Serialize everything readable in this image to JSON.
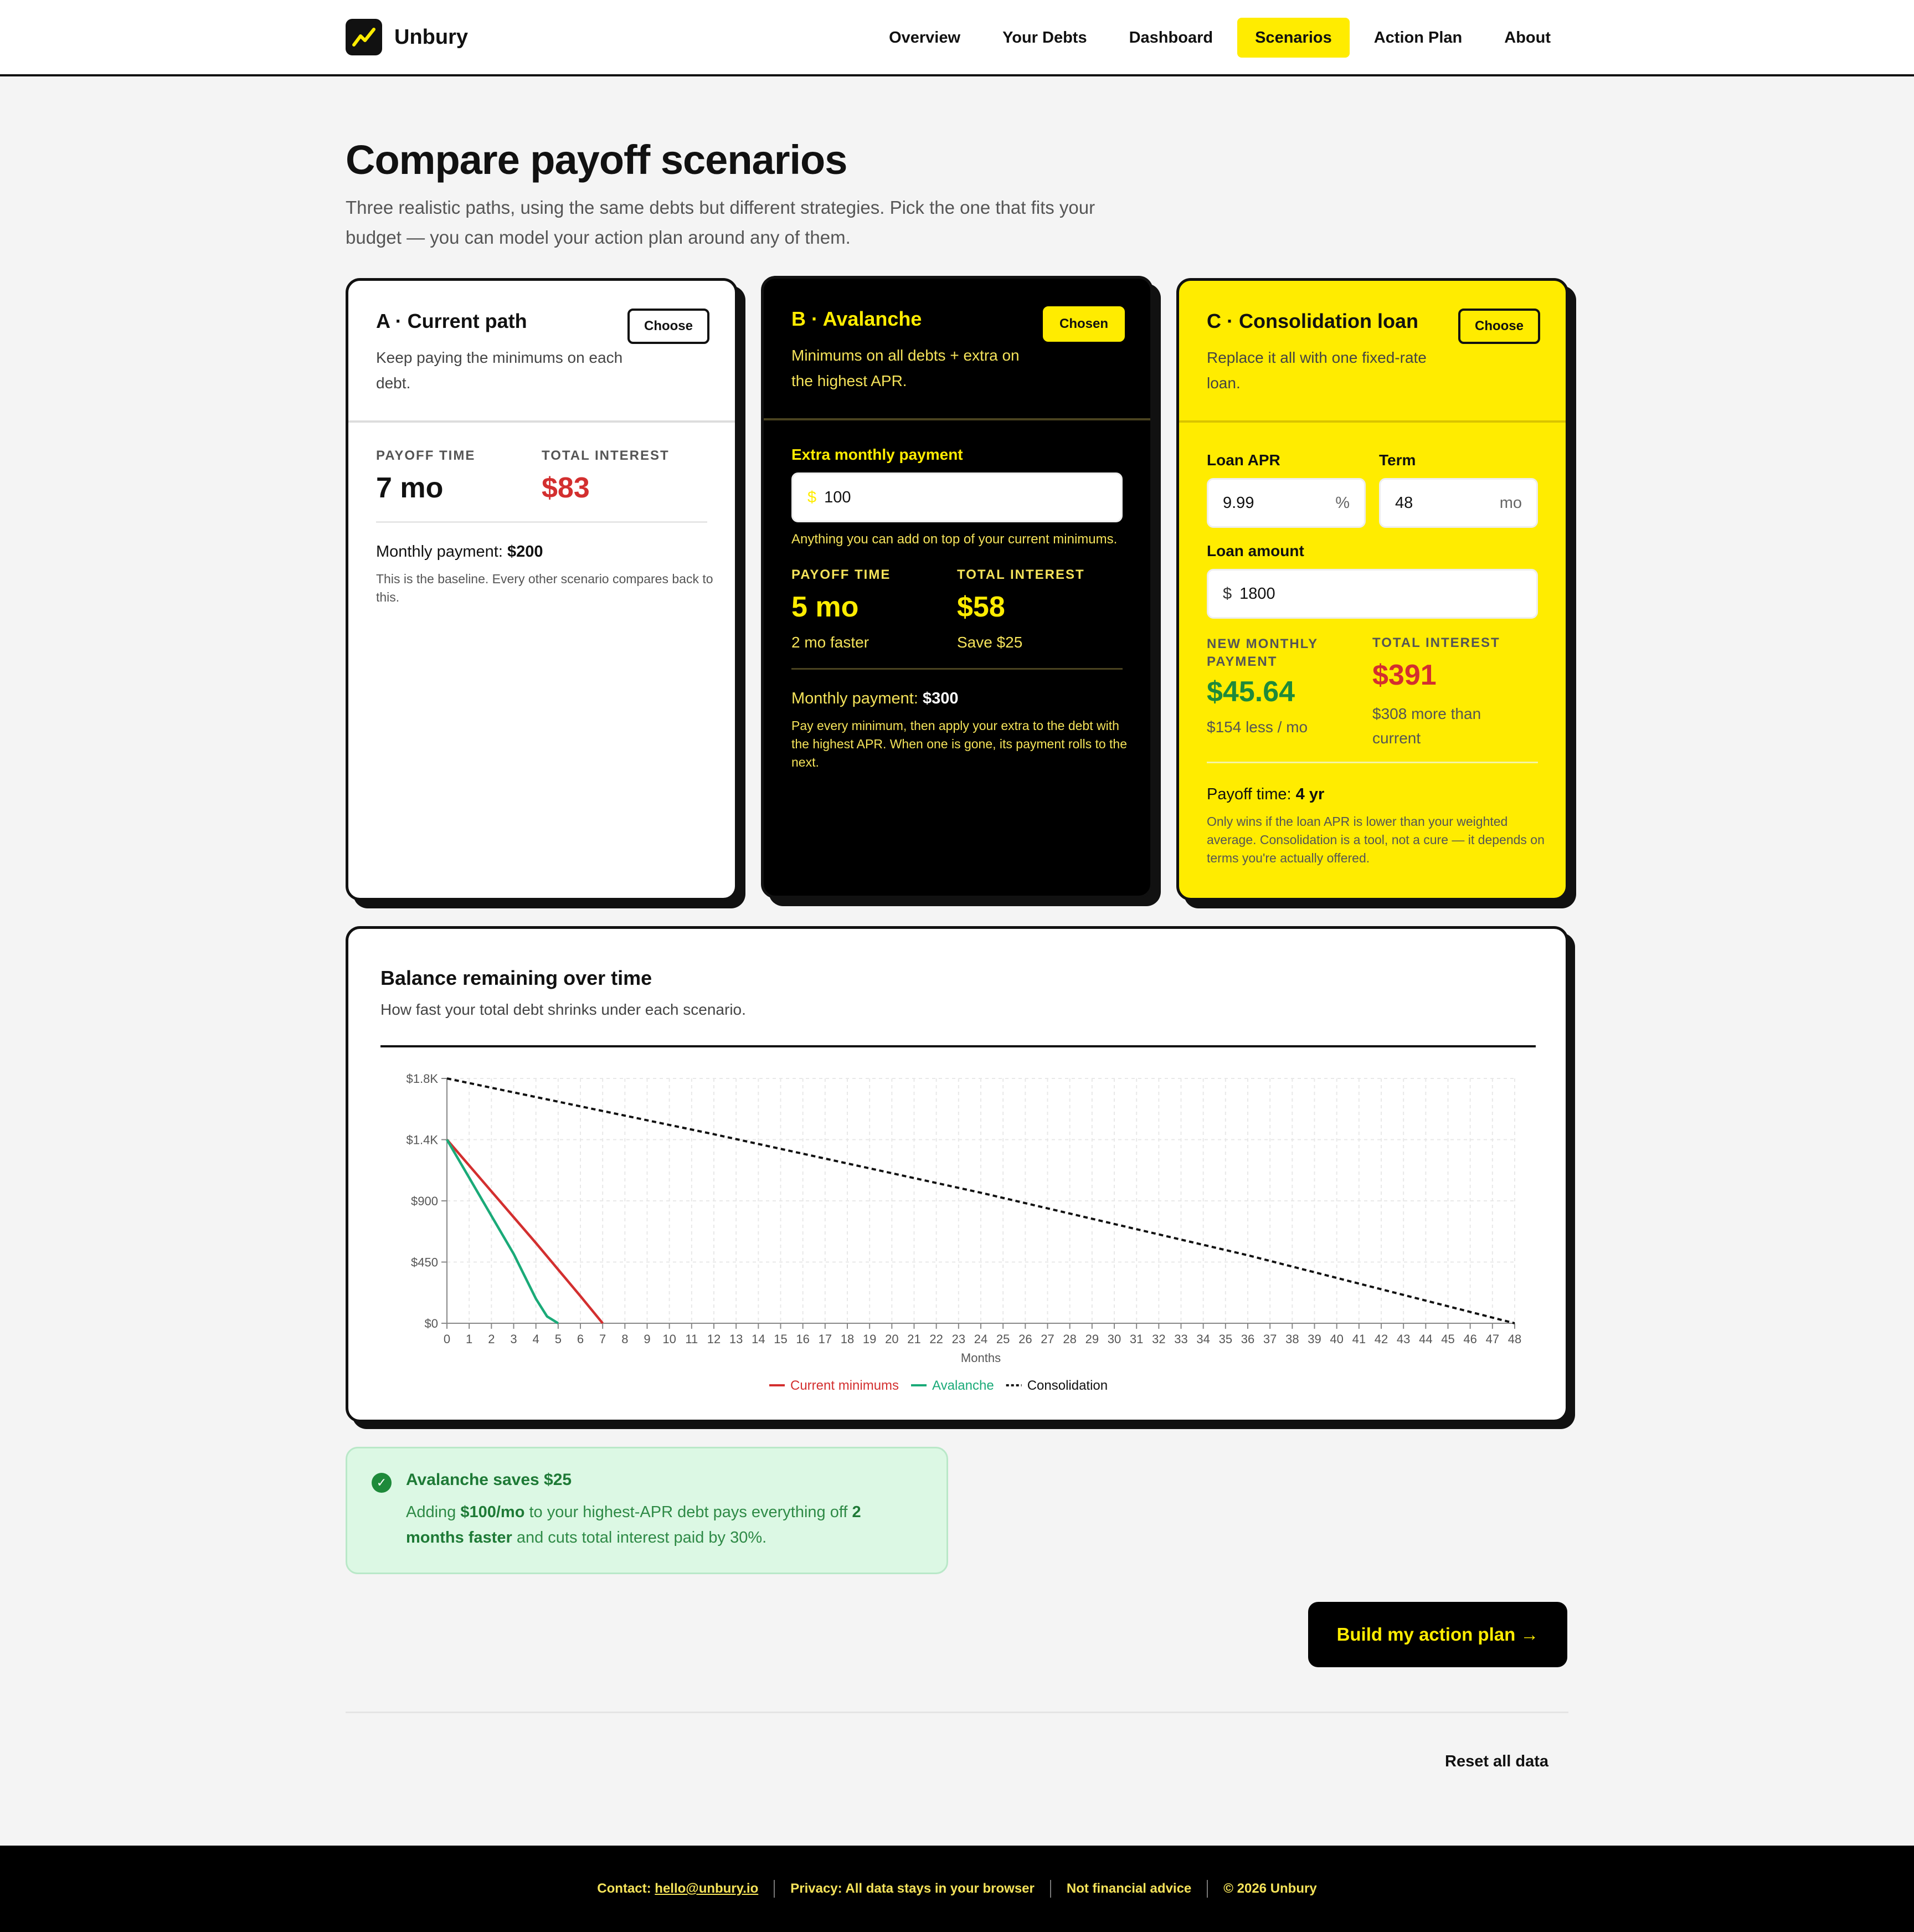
{
  "app": {
    "name": "Unbury",
    "nav": [
      "Overview",
      "Your Debts",
      "Dashboard",
      "Scenarios",
      "Action Plan",
      "About"
    ],
    "active_nav": "Scenarios"
  },
  "page": {
    "title": "Compare payoff scenarios",
    "subtitle": "Three realistic paths, using the same debts but different strategies. Pick the one that fits your budget — you can model your action plan around any of them."
  },
  "card_a": {
    "title": "A · Current path",
    "desc": "Keep paying the minimums on each debt.",
    "button": "Choose",
    "payoff_label": "PAYOFF TIME",
    "payoff_value": "7 mo",
    "interest_label": "TOTAL INTEREST",
    "interest_value": "$83",
    "monthly_label": "Monthly payment:",
    "monthly_value": "$200",
    "note": "This is the baseline. Every other scenario compares back to this."
  },
  "card_b": {
    "title": "B · Avalanche",
    "desc": "Minimums on all debts + extra on the highest APR.",
    "button": "Chosen",
    "extra_label": "Extra monthly payment",
    "extra_prefix": "$",
    "extra_value": "100",
    "extra_help": "Anything you can add on top of your current minimums.",
    "payoff_label": "PAYOFF TIME",
    "payoff_value": "5 mo",
    "payoff_note": "2 mo faster",
    "interest_label": "TOTAL INTEREST",
    "interest_value": "$58",
    "interest_note": "Save $25",
    "monthly_label": "Monthly payment:",
    "monthly_value": "$300",
    "note": "Pay every minimum, then apply your extra to the debt with the highest APR. When one is gone, its payment rolls to the next."
  },
  "card_c": {
    "title": "C · Consolidation loan",
    "desc": "Replace it all with one fixed-rate loan.",
    "button": "Choose",
    "apr_label": "Loan APR",
    "apr_value": "9.99",
    "apr_suffix": "%",
    "term_label": "Term",
    "term_value": "48",
    "term_suffix": "mo",
    "amount_label": "Loan amount",
    "amount_prefix": "$",
    "amount_value": "1800",
    "payment_label": "NEW MONTHLY PAYMENT",
    "payment_value": "$45.64",
    "payment_note": "$154 less / mo",
    "interest_label": "TOTAL INTEREST",
    "interest_value": "$391",
    "interest_note": "$308 more than current",
    "payoff_label": "Payoff time:",
    "payoff_value": "4 yr",
    "note": "Only wins if the loan APR is lower than your weighted average. Consolidation is a tool, not a cure — it depends on terms you're actually offered."
  },
  "chart": {
    "title": "Balance remaining over time",
    "subtitle": "How fast your total debt shrinks under each scenario."
  },
  "chart_data": {
    "type": "line",
    "xlabel": "Months",
    "ylabel": "",
    "x": [
      0,
      48
    ],
    "xlim": [
      0,
      48
    ],
    "ylim": [
      0,
      1800
    ],
    "y_ticks": [
      "$0",
      "$450",
      "$900",
      "$1.4K",
      "$1.8K"
    ],
    "y_tick_values": [
      0,
      450,
      900,
      1350,
      1800
    ],
    "grid": true,
    "legend": "bottom-center",
    "series": [
      {
        "name": "Current minimums",
        "color": "#d32f2f",
        "style": "solid",
        "points": [
          [
            0,
            1350
          ],
          [
            1,
            1160
          ],
          [
            2,
            970
          ],
          [
            3,
            780
          ],
          [
            4,
            590
          ],
          [
            5,
            395
          ],
          [
            6,
            200
          ],
          [
            7,
            0
          ]
        ]
      },
      {
        "name": "Avalanche",
        "color": "#1aaa78",
        "style": "solid",
        "points": [
          [
            0,
            1350
          ],
          [
            1,
            1070
          ],
          [
            2,
            790
          ],
          [
            3,
            510
          ],
          [
            4,
            180
          ],
          [
            4.5,
            50
          ],
          [
            5,
            0
          ]
        ]
      },
      {
        "name": "Consolidation",
        "color": "#111111",
        "style": "dotted",
        "points": [
          [
            0,
            1800
          ],
          [
            12,
            1390
          ],
          [
            24,
            960
          ],
          [
            36,
            500
          ],
          [
            48,
            0
          ]
        ]
      }
    ]
  },
  "callout": {
    "icon": "check-icon",
    "title": "Avalanche saves $25",
    "text_1": "Adding ",
    "text_bold_1": "$100/mo",
    "text_2": " to your highest-APR debt pays everything off ",
    "text_bold_2": "2 months faster",
    "text_3": " and cuts total interest paid by 30%."
  },
  "cta": "Build my action plan →",
  "reset": "Reset all data",
  "footer": {
    "contact_label": "Contact:",
    "contact_email": "hello@unbury.io",
    "privacy": "Privacy: All data stays in your browser",
    "advice": "Not financial advice",
    "copyright": "© 2026 Unbury"
  },
  "colors": {
    "accent": "#ffec00",
    "red": "#d32f2f",
    "green": "#1e8a3a",
    "teal": "#1aaa78"
  }
}
